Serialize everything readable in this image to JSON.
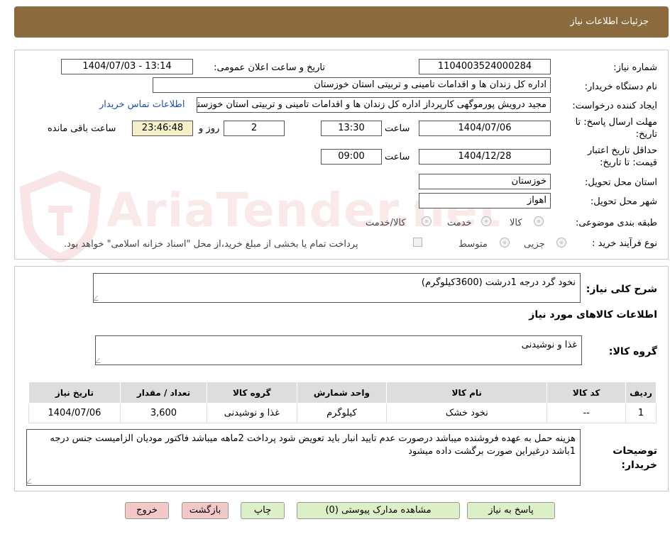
{
  "header": {
    "title": "جزئیات اطلاعات نیاز"
  },
  "form": {
    "need_number": {
      "label": "شماره نیاز:",
      "value": "1104003524000284"
    },
    "announce_datetime": {
      "label": "تاریخ و ساعت اعلان عمومی:",
      "value": "1404/07/03 - 13:14"
    },
    "buyer_org": {
      "label": "نام دستگاه خریدار:",
      "value": "اداره کل زندان ها و اقدامات تامینی و تربیتی استان خوزستان"
    },
    "requester": {
      "label": "ایجاد کننده درخواست:",
      "value": "مجید درویش پورموگهی کارپرداز اداره کل زندان ها و اقدامات تامینی و تربیتی استان خوزستان",
      "contact_link": "اطلاعات تماس خریدار"
    },
    "deadline": {
      "label": "مهلت ارسال پاسخ: تا تاریخ:",
      "date": "1404/07/06",
      "time_label": "ساعت",
      "time": "13:30",
      "days": "2",
      "days_label": "روز و",
      "remaining": "23:46:48",
      "remaining_label": "ساعت باقی مانده"
    },
    "price_validity": {
      "label": "حداقل تاریخ اعتبار قیمت: تا تاریخ:",
      "date": "1404/12/28",
      "time_label": "ساعت",
      "time": "09:00"
    },
    "province": {
      "label": "استان محل تحویل:",
      "value": "خوزستان"
    },
    "city": {
      "label": "شهر محل تحویل:",
      "value": "اهواز"
    },
    "category": {
      "label": "طبقه بندی موضوعی:",
      "options": [
        "کالا",
        "خدمت",
        "کالا/خدمت"
      ]
    },
    "process": {
      "label": "نوع فرآیند خرید :",
      "options": [
        "جزیی",
        "متوسط"
      ],
      "payment_note": "پرداخت تمام یا بخشی از مبلغ خرید،از محل \"اسناد خزانه اسلامی\" خواهد بود."
    }
  },
  "goods": {
    "description_label": "شرح کلی نیاز:",
    "description": "نخود گرد درجه 1درشت (3600کیلوگرم)",
    "section_title": "اطلاعات کالاهای مورد نیاز",
    "group_label": "گروه کالا:",
    "group_value": "غذا و نوشیدنی",
    "table": {
      "headers": [
        "ردیف",
        "کد کالا",
        "نام کالا",
        "واحد شمارش",
        "گروه کالا",
        "تعداد / مقدار",
        "تاریخ نیاز"
      ],
      "rows": [
        [
          "1",
          "--",
          "نخود خشک",
          "کیلوگرم",
          "غذا و نوشیدنی",
          "3,600",
          "1404/07/06"
        ]
      ]
    },
    "buyer_notes_label": "توضیحات خریدار:",
    "buyer_notes": "هزینه حمل به عهده فروشنده میباشد درصورت عدم تایید انبار باید تعویض شود پرداخت 2ماهه میباشد فاکتور مودیان الزامیست جنس درجه 1باشد درغیراین صورت برگشت داده میشود"
  },
  "buttons": {
    "reply": "پاسخ به نیاز",
    "view_docs": "مشاهده مدارک پیوستی (0)",
    "print": "چاپ",
    "back": "بازگشت",
    "exit": "خروج"
  },
  "watermark": {
    "text": "AriaTender.net"
  }
}
